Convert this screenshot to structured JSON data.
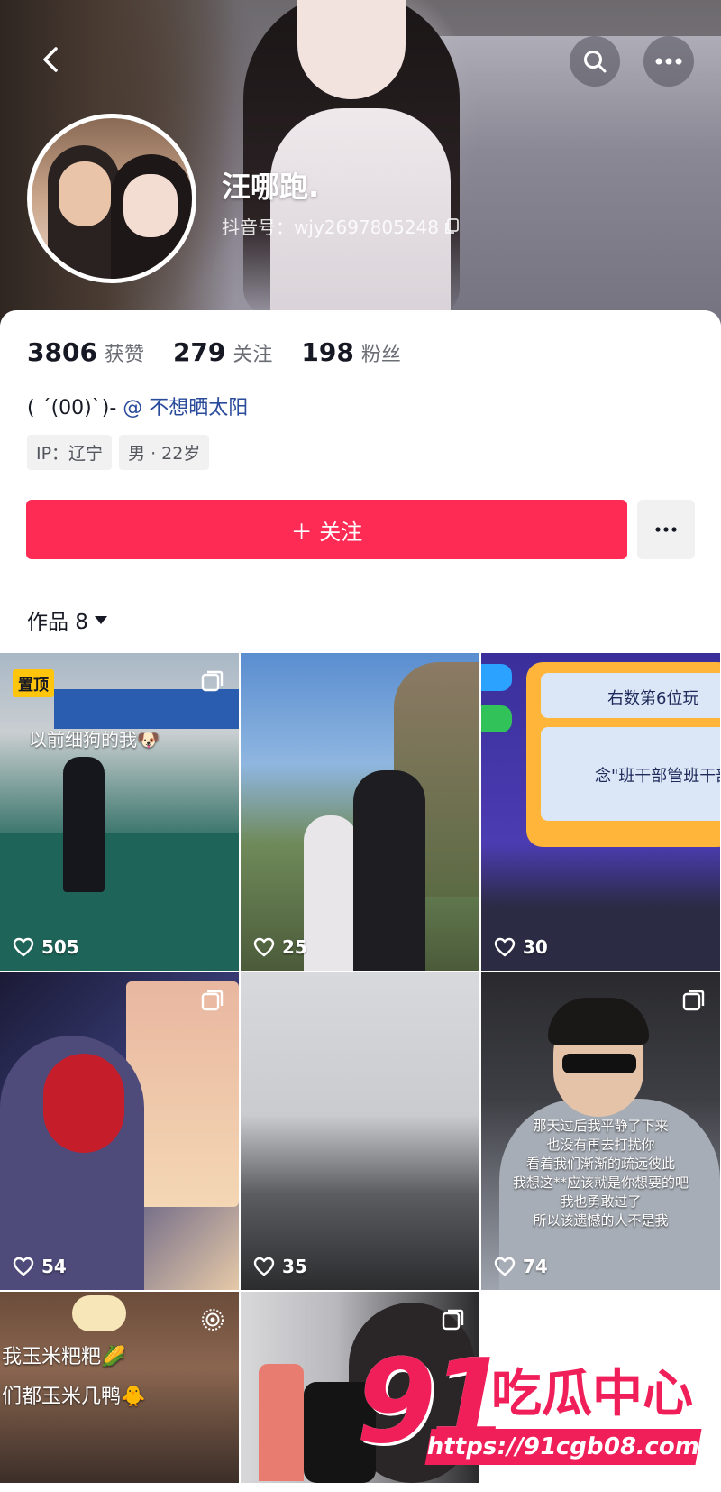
{
  "header": {
    "nickname": "汪哪跑.",
    "douyin_id": "抖音号：wjy2697805248"
  },
  "stats": [
    {
      "value": "3806",
      "label": "获赞"
    },
    {
      "value": "279",
      "label": "关注"
    },
    {
      "value": "198",
      "label": "粉丝"
    }
  ],
  "bio": {
    "text": "( ´(00)`)- ",
    "mention": "@ 不想晒太阳"
  },
  "tags": [
    "IP：辽宁",
    "男 · 22岁"
  ],
  "actions": {
    "follow_label": "＋ 关注"
  },
  "works_tab": {
    "label": "作品 8"
  },
  "videos": [
    {
      "likes": "505",
      "pinned_label": "置顶",
      "caption": "以前细狗的我🐶"
    },
    {
      "likes": "25"
    },
    {
      "likes": "30",
      "screen_line1": "右数第6位玩",
      "screen_line2": "念\"班干部管班干部"
    },
    {
      "likes": "54"
    },
    {
      "likes": "35"
    },
    {
      "likes": "74",
      "lyrics": [
        "那天过后我平静了下来",
        "也没有再去打扰你",
        "看着我们渐渐的疏远彼此",
        "我想这**应该就是你想要的吧",
        "我也勇敢过了",
        "所以该遗憾的人不是我"
      ]
    },
    {
      "caption1": "我玉米粑粑🌽",
      "caption2": "们都玉米几鸭🐥"
    },
    {}
  ],
  "watermark": {
    "number": "91",
    "title": "吃瓜中心",
    "url": "https://91cgb08.com"
  },
  "colors": {
    "accent": "#fe2c55",
    "mention": "#2a4b9b",
    "pinned": "#ffc40c",
    "watermark": "#f01f59"
  }
}
